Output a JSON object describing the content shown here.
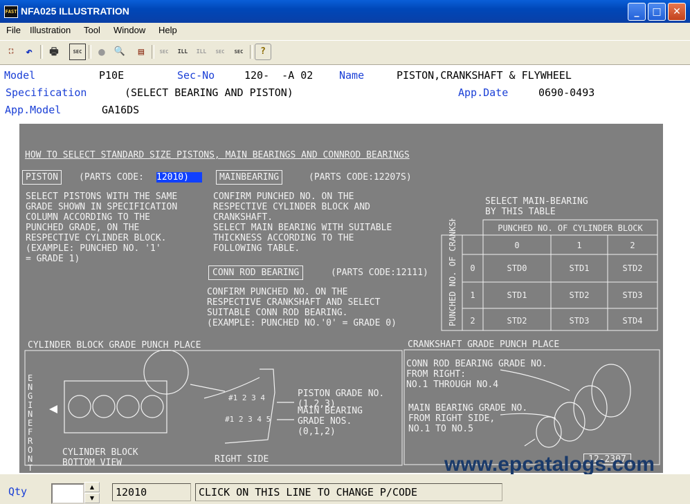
{
  "window": {
    "icon_text": "FAST",
    "title": "NFA025  ILLUSTRATION",
    "min_glyph": "_",
    "max_glyph": "□",
    "close_glyph": "✕"
  },
  "menu": [
    "File",
    "Illustration",
    "Tool",
    "Window",
    "Help"
  ],
  "toolbar": [
    {
      "name": "exit-icon",
      "glyph": "⛶"
    },
    {
      "name": "undo-icon",
      "glyph": "↶"
    },
    {
      "name": "print-icon",
      "glyph": "🖶"
    },
    {
      "name": "sec-icon",
      "glyph": "SEC"
    },
    {
      "name": "circle-icon",
      "glyph": "●"
    },
    {
      "name": "magnifier-icon",
      "glyph": "🔍"
    },
    {
      "name": "book-icon",
      "glyph": "▤"
    },
    {
      "name": "prev-sec-icon",
      "glyph": "SEC"
    },
    {
      "name": "prev-ill-icon",
      "glyph": "ILL"
    },
    {
      "name": "next-ill-icon",
      "glyph": "ILL"
    },
    {
      "name": "next-sec-icon",
      "glyph": "SEC"
    },
    {
      "name": "sec-search-icon",
      "glyph": "SEC"
    },
    {
      "name": "help-icon",
      "glyph": "?"
    }
  ],
  "info": {
    "model_label": "Model",
    "model_value": "P10E",
    "secno_label": "Sec-No",
    "secno_value": "120-  -A 02",
    "name_label": "Name",
    "name_value": "PISTON,CRANKSHAFT & FLYWHEEL",
    "spec_label": "Specification",
    "spec_value": "(SELECT BEARING AND PISTON)",
    "appdate_label": "App.Date",
    "appdate_value": "0690-0493",
    "appmodel_label": "App.Model",
    "appmodel_value": "GA16DS"
  },
  "illustration": {
    "heading": "HOW TO SELECT STANDARD SIZE PISTONS, MAIN BEARINGS AND CONNROD BEARINGS",
    "piston_box": "PISTON",
    "piston_code_prefix": "(PARTS CODE:",
    "piston_code": "12010)",
    "piston_text": "SELECT PISTONS WITH THE SAME\nGRADE SHOWN IN SPECIFICATION\nCOLUMN ACCORDING TO THE\nPUNCHED GRADE, ON THE\nRESPECTIVE CYLINDER BLOCK.\n(EXAMPLE: PUNCHED NO. '1'\n= GRADE 1)",
    "mainbearing_box": "MAINBEARING",
    "mainbearing_code": "(PARTS CODE:12207S)",
    "mainbearing_text": "CONFIRM PUNCHED NO. ON THE\nRESPECTIVE CYLINDER BLOCK AND\nCRANKSHAFT.\nSELECT MAIN BEARING WITH SUITABLE\nTHICKNESS ACCORDING TO THE\nFOLLOWING TABLE.",
    "connrod_box": "CONN ROD BEARING",
    "connrod_code": "(PARTS CODE:12111)",
    "connrod_text": "CONFIRM PUNCHED NO. ON THE\nRESPECTIVE CRANKSHAFT AND SELECT\nSUITABLE CONN ROD BEARING.\n(EXAMPLE: PUNCHED NO.'0' = GRADE 0)",
    "table_title": "SELECT MAIN-BEARING\nBY THIS TABLE",
    "table_col_header": "PUNCHED NO. OF CYLINDER BLOCK",
    "table_row_header": "PUNCHED NO. OF CRANKSHAFT",
    "table_cols": [
      "0",
      "1",
      "2"
    ],
    "table_rows": [
      {
        "label": "0",
        "cells": [
          "STD0",
          "STD1",
          "STD2"
        ]
      },
      {
        "label": "1",
        "cells": [
          "STD1",
          "STD2",
          "STD3"
        ]
      },
      {
        "label": "2",
        "cells": [
          "STD2",
          "STD3",
          "STD4"
        ]
      }
    ],
    "cyl_title": "CYLINDER BLOCK GRADE PUNCH PLACE",
    "engine_front": "ENGINE FRONT",
    "piston_grade": "PISTON GRADE NO.\n(1,2,3)",
    "main_bearing_grade": "MAIN BEARING\nGRADE NOS.\n(0,1,2)",
    "punch_row1": "#1 2 3 4",
    "punch_row2": "#1 2 3 4 5",
    "cyl_caption": "CYLINDER BLOCK\nBOTTOM VIEW",
    "right_side": "RIGHT SIDE",
    "crank_title": "CRANKSHAFT GRADE PUNCH PLACE",
    "crank_connrod": "CONN ROD BEARING GRADE NO.\nFROM RIGHT:\nNO.1 THROUGH NO.4",
    "crank_main": "MAIN BEARING GRADE NO.\nFROM RIGHT SIDE,\nNO.1 TO NO.5",
    "crank_code": "12-2307"
  },
  "watermark": "www.epcatalogs.com",
  "status": {
    "qty_label": "Qty",
    "qty_value": "",
    "pcode_value": "12010",
    "hint": "CLICK ON THIS LINE TO CHANGE P/CODE",
    "spin_up": "▲",
    "spin_down": "▼"
  }
}
